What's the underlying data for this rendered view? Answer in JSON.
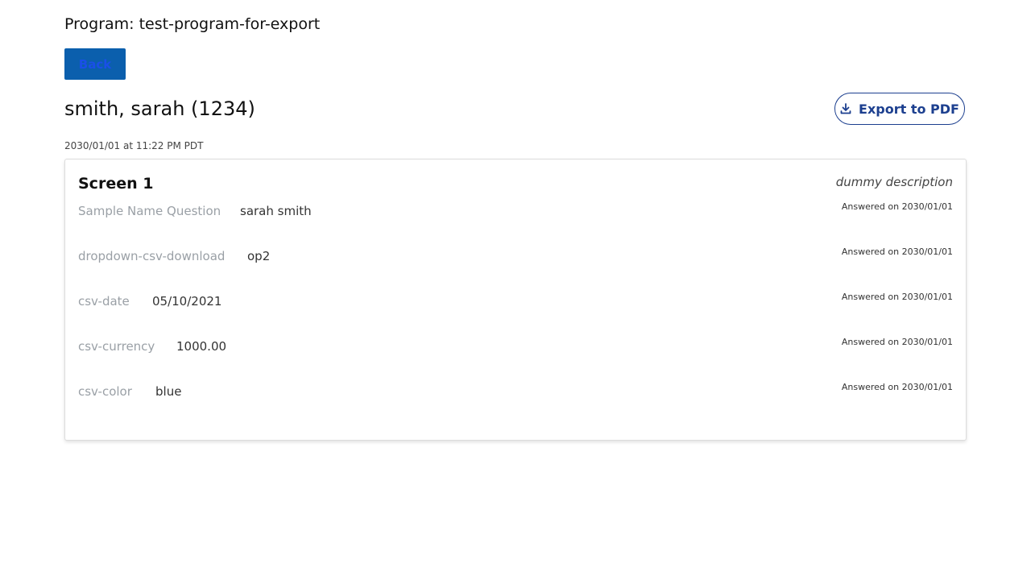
{
  "header": {
    "program_title": "Program: test-program-for-export",
    "back_label": "Back"
  },
  "applicant": {
    "name": "smith, sarah (1234)",
    "submit_time": "2030/01/01 at 11:22 PM PDT"
  },
  "export": {
    "label": "Export to PDF",
    "icon": "download-icon"
  },
  "screen": {
    "title": "Screen 1",
    "description": "dummy description",
    "answers": [
      {
        "question": "Sample Name Question",
        "value": "sarah smith",
        "answered": "Answered on 2030/01/01"
      },
      {
        "question": "dropdown-csv-download",
        "value": "op2",
        "answered": "Answered on 2030/01/01"
      },
      {
        "question": "csv-date",
        "value": "05/10/2021",
        "answered": "Answered on 2030/01/01"
      },
      {
        "question": "csv-currency",
        "value": "1000.00",
        "answered": "Answered on 2030/01/01"
      },
      {
        "question": "csv-color",
        "value": "blue",
        "answered": "Answered on 2030/01/01"
      }
    ]
  },
  "colors": {
    "primary": "#0b5fad",
    "export_accent": "#1c3f8f"
  }
}
